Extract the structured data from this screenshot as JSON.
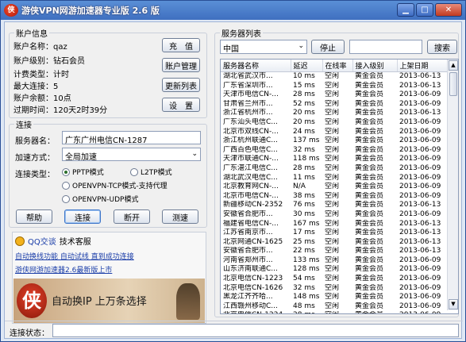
{
  "window": {
    "title": "游侠VPN网游加速器专业版 2.6 版",
    "logo_text": "侠"
  },
  "account": {
    "legend": "账户信息",
    "fields": [
      {
        "label": "账户名称",
        "value": "qaz"
      },
      {
        "label": "账户级别",
        "value": "钻石会员"
      },
      {
        "label": "计费类型",
        "value": "计时"
      },
      {
        "label": "最大连接",
        "value": "5"
      },
      {
        "label": "账户余额",
        "value": "10点"
      },
      {
        "label": "过期时间",
        "value": "120天2时39分"
      }
    ],
    "buttons": {
      "recharge": "充　值",
      "manage": "账户管理",
      "refresh": "更新列表",
      "settings": "设　置"
    }
  },
  "connect": {
    "legend": "连接",
    "server_label": "服务器名：",
    "server_value": "广东广州电信CN-1287",
    "mode_label": "加速方式：",
    "mode_value": "全局加速",
    "type_label": "连接类型：",
    "types": {
      "pptp": "PPTP模式",
      "l2tp": "L2TP模式",
      "openvpn_tcp": "OPENVPN-TCP模式-支持代理",
      "openvpn_udp": "OPENVPN-UDP模式"
    },
    "buttons": {
      "help": "帮助",
      "connect": "连接",
      "disconnect": "断开",
      "speedtest": "测速"
    }
  },
  "promo": {
    "qq_label": "QQ交谈",
    "support_label": "技术客服",
    "link1": "自动换线功能 自动试线 直到成功连接",
    "link2": "游侠网游加速器2.6最新版上市",
    "banner_text": "自动换IP 上万条选择",
    "banner_logo": "侠"
  },
  "servers": {
    "legend": "服务器列表",
    "region": "中国",
    "stop_label": "停止",
    "search_label": "搜索",
    "columns": [
      "服务器名称",
      "延迟",
      "在线率",
      "接入级别",
      "上架日期"
    ],
    "rows": [
      [
        "湖北省武汉市...",
        "10 ms",
        "空闲",
        "黄金会员",
        "2013-06-13"
      ],
      [
        "广东省深圳市...",
        "15 ms",
        "空闲",
        "黄金会员",
        "2013-06-13"
      ],
      [
        "天津市电信CN-...",
        "28 ms",
        "空闲",
        "黄金会员",
        "2013-06-09"
      ],
      [
        "甘肃省兰州市...",
        "52 ms",
        "空闲",
        "黄金会员",
        "2013-06-09"
      ],
      [
        "浙江省杭州市...",
        "20 ms",
        "空闲",
        "黄金会员",
        "2013-06-13"
      ],
      [
        "广东汕头电信C...",
        "20 ms",
        "空闲",
        "黄金会员",
        "2013-06-09"
      ],
      [
        "北京市双线CN-...",
        "24 ms",
        "空闲",
        "黄金会员",
        "2013-06-09"
      ],
      [
        "浙江杭州联通C...",
        "137 ms",
        "空闲",
        "黄金会员",
        "2013-06-09"
      ],
      [
        "广西百色电信C...",
        "32 ms",
        "空闲",
        "黄金会员",
        "2013-06-09"
      ],
      [
        "天津市联通CN-...",
        "118 ms",
        "空闲",
        "黄金会员",
        "2013-06-09"
      ],
      [
        "广东湛江电信C...",
        "28 ms",
        "空闲",
        "黄金会员",
        "2013-06-09"
      ],
      [
        "湖北武汉电信C...",
        "11 ms",
        "空闲",
        "黄金会员",
        "2013-06-09"
      ],
      [
        "北京教育网CN-...",
        "N/A",
        "空闲",
        "黄金会员",
        "2013-06-09"
      ],
      [
        "北京市电信CN-...",
        "38 ms",
        "空闲",
        "黄金会员",
        "2013-06-09"
      ],
      [
        "新疆移动CN-2352",
        "76 ms",
        "空闲",
        "黄金会员",
        "2013-06-13"
      ],
      [
        "安徽省合肥市...",
        "30 ms",
        "空闲",
        "黄金会员",
        "2013-06-09"
      ],
      [
        "福建省电信CN-...",
        "167 ms",
        "空闲",
        "黄金会员",
        "2013-06-13"
      ],
      [
        "江苏省南京市...",
        "17 ms",
        "空闲",
        "黄金会员",
        "2013-06-13"
      ],
      [
        "北京网通CN-1625",
        "25 ms",
        "空闲",
        "黄金会员",
        "2013-06-13"
      ],
      [
        "安徽省合肥市...",
        "22 ms",
        "空闲",
        "黄金会员",
        "2013-06-13"
      ],
      [
        "河南省郑州市...",
        "133 ms",
        "空闲",
        "黄金会员",
        "2013-06-09"
      ],
      [
        "山东济南联通C...",
        "128 ms",
        "空闲",
        "黄金会员",
        "2013-06-09"
      ],
      [
        "北京电信CN-1223",
        "54 ms",
        "空闲",
        "黄金会员",
        "2013-06-09"
      ],
      [
        "北京电信CN-1626",
        "32 ms",
        "空闲",
        "黄金会员",
        "2013-06-09"
      ],
      [
        "黑龙江齐齐哈...",
        "148 ms",
        "空闲",
        "黄金会员",
        "2013-06-09"
      ],
      [
        "江西赣州移动C...",
        "48 ms",
        "空闲",
        "黄金会员",
        "2013-06-09"
      ],
      [
        "北京电信CN-1224",
        "28 ms",
        "空闲",
        "黄金会员",
        "2013-06-09"
      ],
      [
        "上海市电信CN-...",
        "27 ms",
        "空闲",
        "黄金会员",
        "2013-06-13"
      ]
    ]
  },
  "status": {
    "label": "连接状态：",
    "value": ""
  }
}
